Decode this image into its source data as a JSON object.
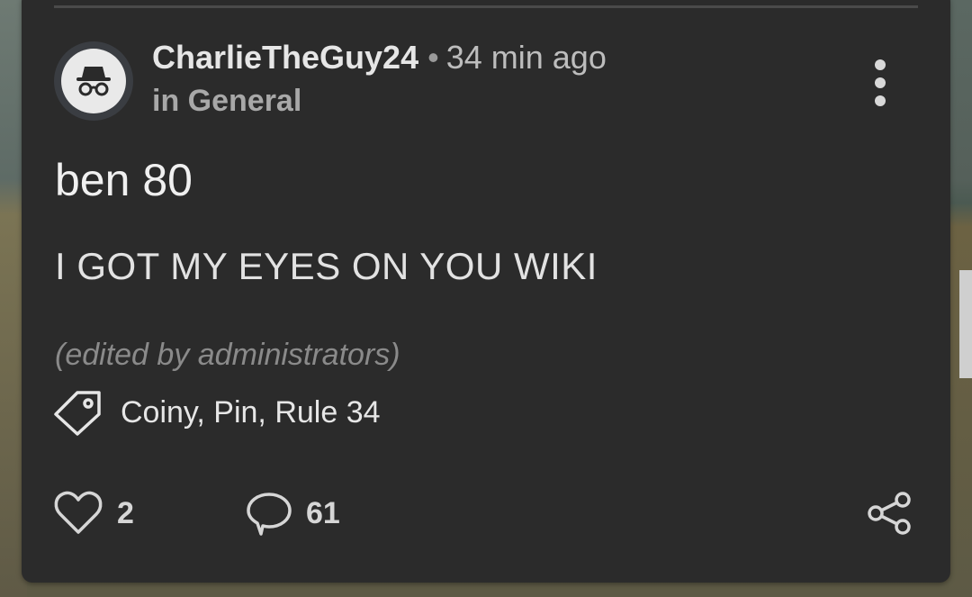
{
  "post": {
    "author": "CharlieTheGuy24",
    "separator": "•",
    "time_ago": "34 min ago",
    "category": "in General",
    "title": "ben 80",
    "body": "I GOT MY EYES ON YOU WIKI",
    "edited_note": "(edited by administrators)",
    "tags": "Coiny, Pin, Rule 34",
    "likes": "2",
    "comments": "61"
  },
  "icons": {
    "avatar": "incognito-icon",
    "menu": "more-vertical-icon",
    "tag": "tag-icon",
    "like": "heart-icon",
    "comment": "comment-icon",
    "share": "share-icon"
  },
  "colors": {
    "card_background": "#2b2b2b",
    "primary_text": "#f0f0f0",
    "secondary_text": "#a8a8a8",
    "edited_text": "#8a8a8a"
  }
}
